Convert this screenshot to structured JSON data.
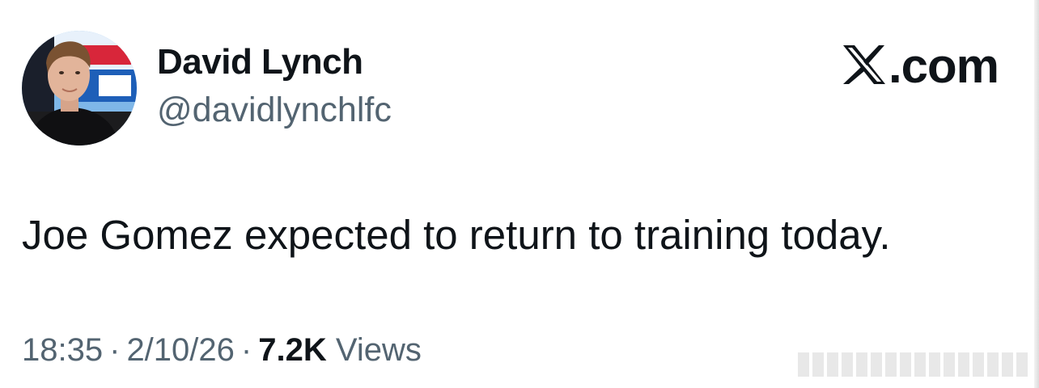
{
  "author": {
    "display_name": "David Lynch",
    "handle": "@davidlynchlfc",
    "avatar_icon": "avatar-photo"
  },
  "brand": {
    "logo_icon": "x-logo-icon",
    "text": ".com"
  },
  "tweet": {
    "text": "Joe Gomez expected to return to training today."
  },
  "meta": {
    "time": "18:35",
    "separator": "·",
    "date": "2/10/26",
    "views_count": "7.2K",
    "views_label": "Views"
  },
  "colors": {
    "primary_text": "#0f1419",
    "secondary_text": "#536471",
    "background": "#ffffff"
  }
}
